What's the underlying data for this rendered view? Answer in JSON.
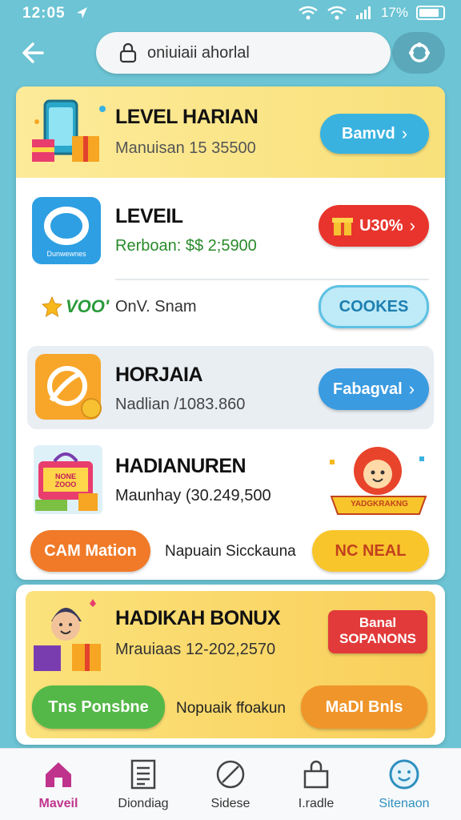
{
  "status": {
    "time": "12:05",
    "battery": "17%"
  },
  "search": {
    "text": "oniuiaii ahorlal"
  },
  "harian": {
    "title": "LEVEL HARIAN",
    "subtitle": "Manuisan 15 35500",
    "button": "Bamvd"
  },
  "level": {
    "title": "LEVEIL",
    "subtitle": "Rerboan: $$ 2;5900",
    "badge": "U30%",
    "app_icon_text": "Dunwewnes"
  },
  "coin_row": {
    "label": "VOO'",
    "text": "OnV. Snam",
    "button": "COOKES"
  },
  "horjaia": {
    "title": "HORJAIA",
    "subtitle": "Nadlian /1083.860",
    "button": "Fabagval"
  },
  "hadian": {
    "title": "HADIANUREN",
    "subtitle": "Maunhay (30.249,500",
    "box_text": "NONE ZOOO",
    "banner_text": "YADGKRAKNG"
  },
  "action_row": {
    "left_button": "CAM Mation",
    "text": "Napuain Sicckauna",
    "right_button": "NC NEAL"
  },
  "bonus": {
    "title": "HADIKAH BONUX",
    "subtitle": "Mrauiaas 12-202,2570",
    "tag_line1": "Banal",
    "tag_line2": "SOPANONS",
    "left_button": "Tns Ponsbne",
    "text": "Nopuaik ffoakun",
    "right_button": "MaDI Bnls"
  },
  "nav": {
    "items": [
      {
        "label": "Maveil",
        "icon": "home-icon",
        "active": true
      },
      {
        "label": "Diondiag",
        "icon": "list-icon",
        "active": false
      },
      {
        "label": "Sidese",
        "icon": "slash-circle-icon",
        "active": false
      },
      {
        "label": "I.radle",
        "icon": "bag-icon",
        "active": false
      },
      {
        "label": "Sitenaon",
        "icon": "smile-ring-icon",
        "active": false
      }
    ]
  },
  "colors": {
    "background": "#6cc4d4",
    "blue_pill": "#3ab2df",
    "red_pill": "#e8342c",
    "yellow_pill": "#f8c52b",
    "orange_pill": "#f07a28",
    "green_pill": "#54b848",
    "nav_active": "#c0338c"
  }
}
